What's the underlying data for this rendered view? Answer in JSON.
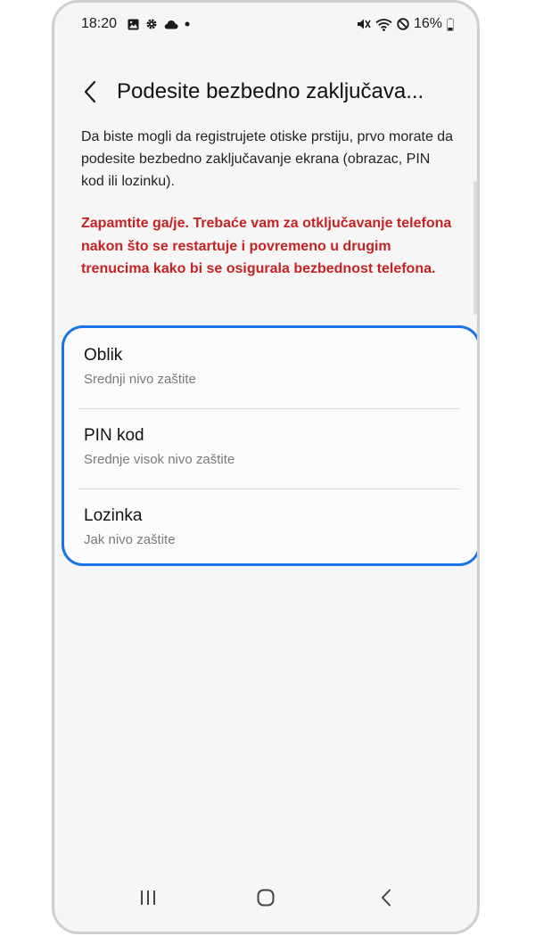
{
  "status_bar": {
    "time": "18:20",
    "battery": "16%",
    "left_icons": [
      "gallery-icon",
      "settings-gear-icon",
      "cloud-icon",
      "dot-icon"
    ],
    "right_icons": [
      "mute-vibrate-icon",
      "wifi-icon",
      "do-not-disturb-icon",
      "battery-icon"
    ]
  },
  "header": {
    "back_icon": "chevron-left-icon",
    "title": "Podesite bezbedno zaključava..."
  },
  "content": {
    "description": "Da biste mogli da registrujete otiske prstiju, prvo morate da podesite bezbedno zaključavanje ekrana (obrazac, PIN kod ili lozinku).",
    "warning": "Zapamtite ga/je. Trebaće vam za otključavanje telefona nakon što se restartuje i povremeno u drugim trenucima kako bi se osigurala bezbednost telefona."
  },
  "options": [
    {
      "title": "Oblik",
      "subtitle": "Srednji nivo zaštite"
    },
    {
      "title": "PIN kod",
      "subtitle": "Srednje visok nivo zaštite"
    },
    {
      "title": "Lozinka",
      "subtitle": "Jak nivo zaštite"
    }
  ],
  "nav_bar": {
    "icons": [
      "recent-apps-icon",
      "home-icon",
      "back-icon"
    ]
  },
  "colors": {
    "accent": "#1a73e8",
    "warning": "#c62222",
    "background": "#f6f6f6"
  }
}
